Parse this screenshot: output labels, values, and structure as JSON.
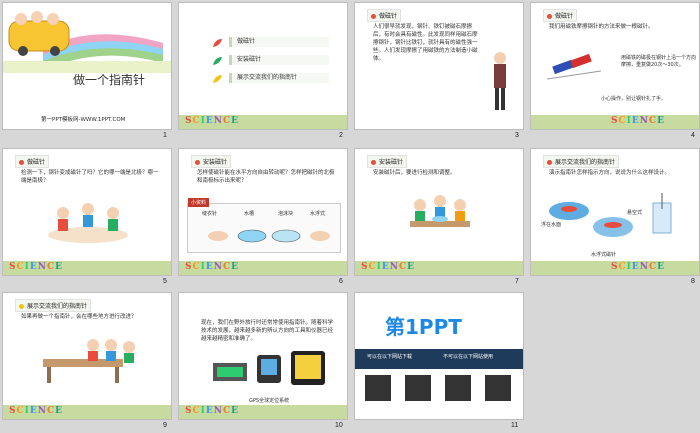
{
  "slides": [
    {
      "id": 1,
      "title": "做一个指南针",
      "footer": "第一PPT模板网-WWW.1PPT.COM",
      "number": "1"
    },
    {
      "id": 2,
      "number": "2",
      "menu": [
        "做磁针",
        "安装磁针",
        "展示交流我们的指南针"
      ]
    },
    {
      "id": 3,
      "number": "3",
      "tag": "做磁针",
      "text": "人们很早就发现，钢针、铁钉被磁石摩擦后，有时会具有磁性。此发现同样用磁石摩擦钢针，钢针比铁钉，就针具有的磁性强一些。人们发现摩擦了用磁铁的方法制造小磁体。"
    },
    {
      "id": 4,
      "number": "4",
      "tag": "做磁针",
      "text": "我们用磁铁摩擦钢针的方法来做一根磁针。",
      "note": "用磁铁的磁极在钢针上沿一个方向摩擦，重复做20次～30次。",
      "warn": "小心操作，别让钢针扎了手。"
    },
    {
      "id": 5,
      "number": "5",
      "tag": "做磁针",
      "text": "检测一下，钢针变成磁针了吗？它的哪一端是北极？哪一端是南极？"
    },
    {
      "id": 6,
      "number": "6",
      "tag": "安装磁针",
      "text": "怎样使磁针能在水平方向自由转动呢？怎样把磁针的北极和南极标示出来呢？",
      "box": "小资料",
      "labels": [
        "缝衣针",
        "水槽",
        "泡沫块",
        "水浮式"
      ]
    },
    {
      "id": 7,
      "number": "7",
      "tag": "安装磁针",
      "text": "安装磁针后，要进行检测和调整。"
    },
    {
      "id": 8,
      "number": "8",
      "tag": "展示交流我们的指南针",
      "text": "演示指南针怎样指示方向，说说为什么这样设计。",
      "labels": [
        "浮在水面",
        "悬空式",
        "水浮式磁针"
      ]
    },
    {
      "id": 9,
      "number": "9",
      "tag": "展示交流我们的指南针",
      "text": "如果再做一个指南针，会在哪些地方进行改进？"
    },
    {
      "id": 10,
      "number": "10",
      "text": "现在，我们在野外旅行时还常常使用指南针。随着科学技术的发展，越来越多新的辨认方向的工具和仪器已经越来越精密和准确了。",
      "label": "GPS全球定位系统"
    },
    {
      "id": 11,
      "number": "11",
      "logo": "第1PPT",
      "links": [
        "可以在以下网站下载",
        "不可以在以下网站使用"
      ]
    }
  ],
  "science": [
    "S",
    "C",
    "I",
    "E",
    "N",
    "C",
    "E"
  ]
}
